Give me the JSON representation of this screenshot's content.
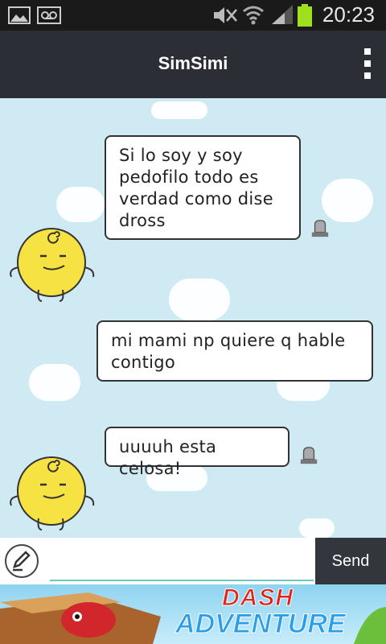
{
  "status_bar": {
    "time": "20:23",
    "icons": [
      "image-icon",
      "voicemail-icon",
      "mute-icon",
      "wifi-icon",
      "signal-icon",
      "battery-icon"
    ]
  },
  "app_bar": {
    "title": "SimSimi",
    "menu_icon": "overflow-menu-icon"
  },
  "messages": [
    {
      "sender": "simsimi",
      "text": "Si lo soy y soy pedofilo todo es verdad como dise dross"
    },
    {
      "sender": "user",
      "text": "mi mami np quiere q hable contigo"
    },
    {
      "sender": "simsimi",
      "text": "uuuuh esta celosa!"
    }
  ],
  "input": {
    "value": "",
    "placeholder": "",
    "send_label": "Send"
  },
  "ad": {
    "line1": "DASH",
    "line2": "ADVENTURE"
  },
  "colors": {
    "chat_background": "#cfeaf3",
    "app_bar": "#2b2e35",
    "accent": "#6cc7c0",
    "character": "#f7e244"
  }
}
